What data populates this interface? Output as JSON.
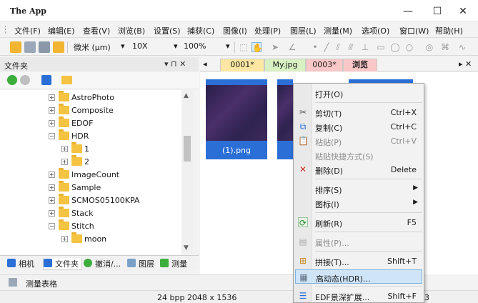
{
  "app": {
    "title": "The App"
  },
  "window_controls": {
    "minimize": "—",
    "maximize": "☐",
    "close": "✕"
  },
  "menu": [
    "文件(F)",
    "编辑(E)",
    "查看(V)",
    "浏览(B)",
    "设置(S)",
    "捕获(C)",
    "图像(I)",
    "处理(P)",
    "图层(L)",
    "测量(M)",
    "选项(O)",
    "窗口(W)",
    "帮助(H)"
  ],
  "toolbar": {
    "unit": "微米 (μm)",
    "objective": "10X",
    "zoom": "100%"
  },
  "left_panel": {
    "title": "文件夹",
    "pin": "▾  ⊓  ✕",
    "tree": [
      {
        "label": "AstroPhoto",
        "level": 0,
        "expander": "+"
      },
      {
        "label": "Composite",
        "level": 0,
        "expander": "+"
      },
      {
        "label": "EDOF",
        "level": 0,
        "expander": "+"
      },
      {
        "label": "HDR",
        "level": 0,
        "expander": "−"
      },
      {
        "label": "1",
        "level": 1,
        "expander": "+"
      },
      {
        "label": "2",
        "level": 1,
        "expander": "+"
      },
      {
        "label": "ImageCount",
        "level": 0,
        "expander": "+"
      },
      {
        "label": "Sample",
        "level": 0,
        "expander": "+"
      },
      {
        "label": "SCMOS05100KPA",
        "level": 0,
        "expander": "+"
      },
      {
        "label": "Stack",
        "level": 0,
        "expander": "+"
      },
      {
        "label": "Stitch",
        "level": 0,
        "expander": "−"
      },
      {
        "label": "moon",
        "level": 1,
        "expander": "+"
      }
    ],
    "bottom_tabs": [
      "相机",
      "文件夹",
      "撤消/...",
      "图层",
      "测量"
    ]
  },
  "measure_table": {
    "label": "测量表格"
  },
  "doc_tabs": {
    "nav_left": "◂",
    "nav_right": "▸  ✕",
    "tabs": [
      "0001*",
      "My.jpg",
      "0003*",
      "浏览"
    ]
  },
  "thumbnails": [
    {
      "label": "(1).png"
    }
  ],
  "context_menu": {
    "items": [
      {
        "label": "打开(O)",
        "shortcut": "",
        "icon": "",
        "disabled": false
      },
      {
        "label": "剪切(T)",
        "shortcut": "Ctrl+X",
        "icon": "✂",
        "disabled": false
      },
      {
        "label": "复制(C)",
        "shortcut": "Ctrl+C",
        "icon": "⧉",
        "disabled": false
      },
      {
        "label": "粘贴(P)",
        "shortcut": "Ctrl+V",
        "icon": "📋",
        "disabled": true
      },
      {
        "label": "粘贴快捷方式(S)",
        "shortcut": "",
        "icon": "",
        "disabled": true
      },
      {
        "label": "删除(D)",
        "shortcut": "Delete",
        "icon": "✕",
        "disabled": false
      },
      {
        "label": "排序(S)",
        "shortcut": "",
        "icon": "",
        "disabled": false
      },
      {
        "label": "图标(I)",
        "shortcut": "",
        "icon": "",
        "disabled": false
      },
      {
        "label": "刷新(R)",
        "shortcut": "F5",
        "icon": "⟳",
        "disabled": false
      },
      {
        "label": "属性(P)...",
        "shortcut": "",
        "icon": "▤",
        "disabled": true
      },
      {
        "label": "拼接(T)...",
        "shortcut": "Shift+T",
        "icon": "⊞",
        "disabled": false
      },
      {
        "label": "高动态(HDR)...",
        "shortcut": "",
        "icon": "▦",
        "disabled": false
      },
      {
        "label": "EDF景深扩展...",
        "shortcut": "Shift+F",
        "icon": "☰",
        "disabled": false
      }
    ],
    "submenu_arrow": "▶"
  },
  "status": {
    "info": "24 bpp  2048 x 1536",
    "extra": "3"
  },
  "colors": {
    "accent_blue": "#2b6fd6",
    "tab_yellow": "#fde7a2",
    "tab_green": "#d9f0c2",
    "tab_pink": "#f9c7c7",
    "folder": "#f5c342"
  }
}
